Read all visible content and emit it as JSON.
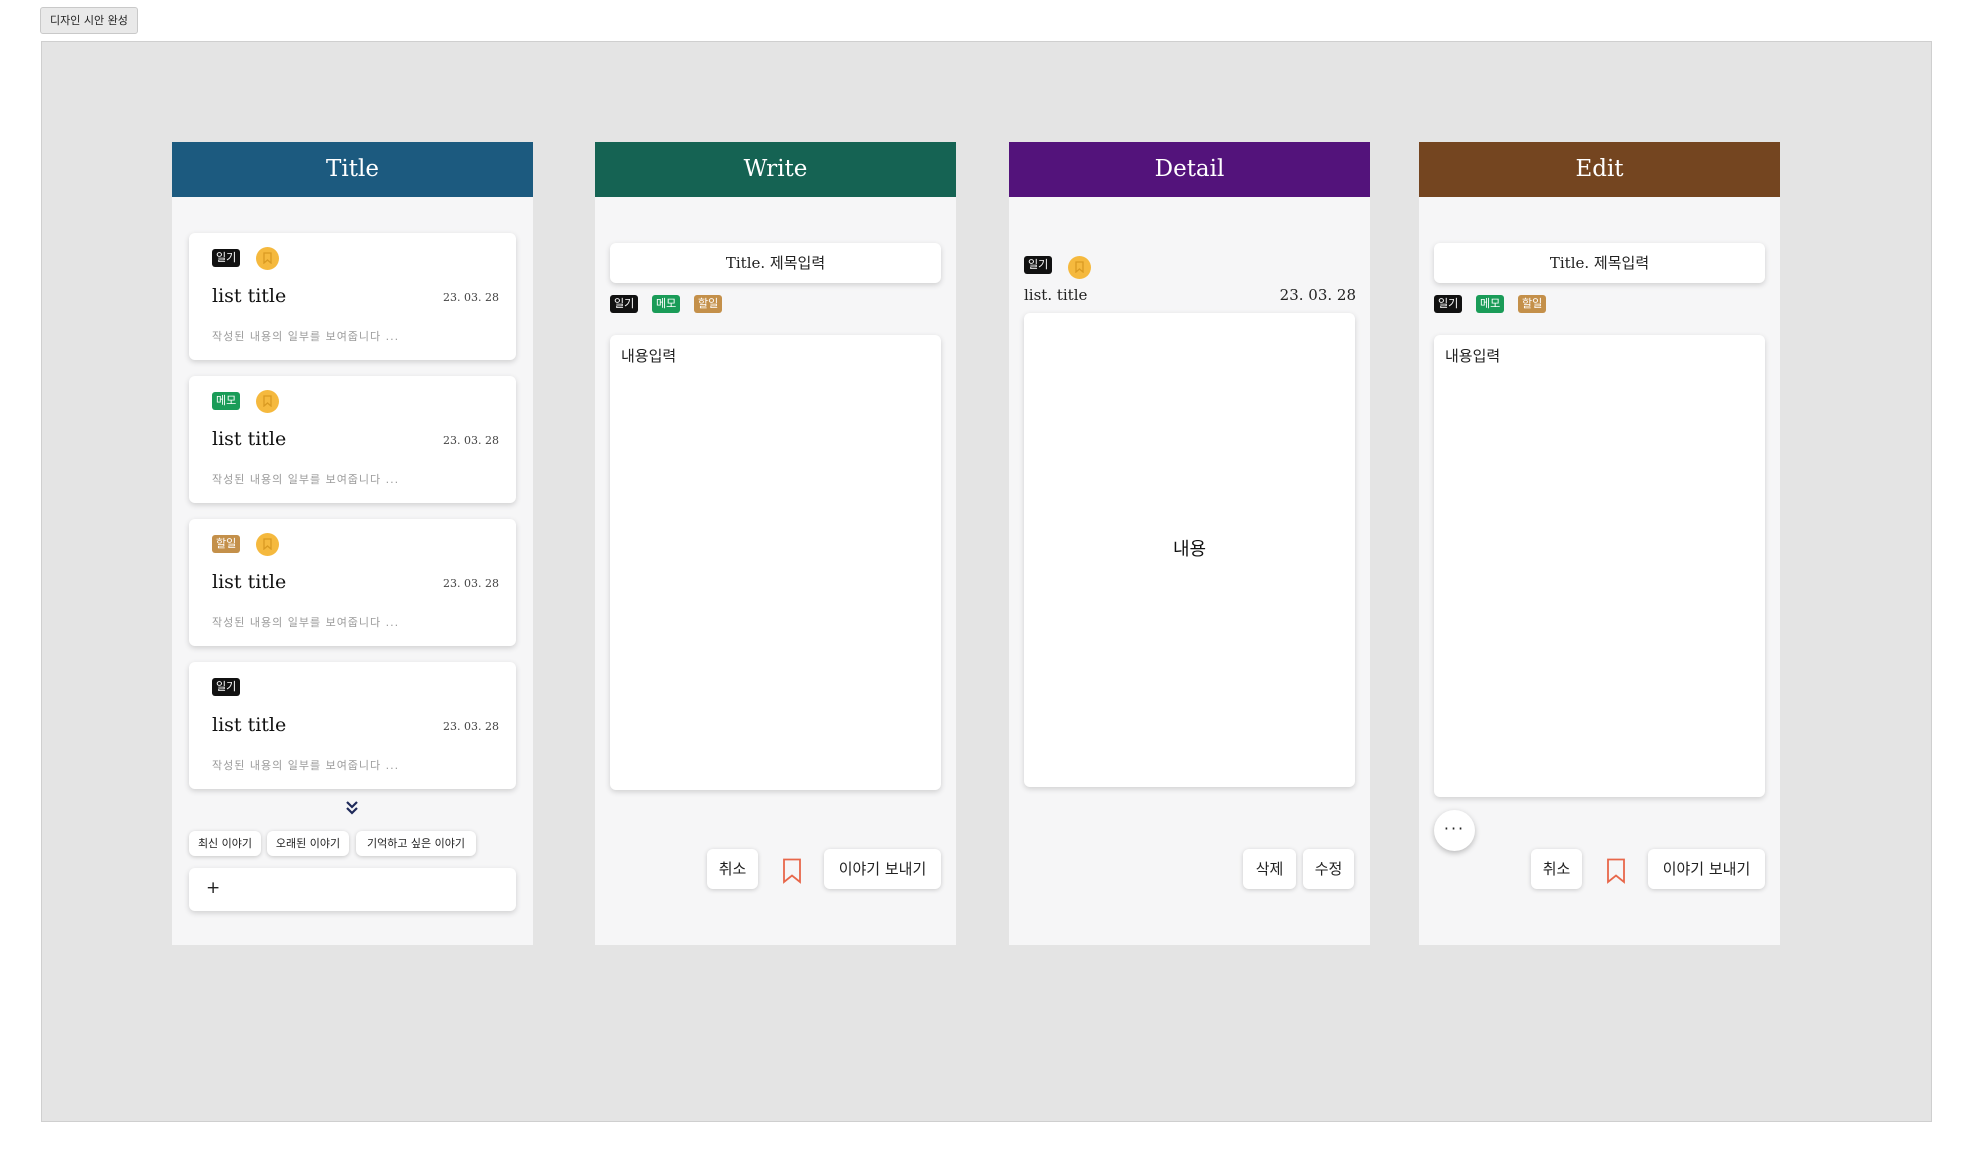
{
  "frame_label": "디자인 시안 완성",
  "colors": {
    "list_header": "#1c5a7f",
    "write_header": "#156353",
    "detail_header": "#53137b",
    "edit_header": "#744520",
    "tag_diary": "#111111",
    "tag_memo": "#1a9c58",
    "tag_todo": "#c4904a",
    "bookmark": "#f5b93e",
    "bookmark_outline": "#e8674a"
  },
  "list_screen": {
    "title": "Title",
    "cards": [
      {
        "tag": "일기",
        "title": "list title",
        "date": "23. 03. 28",
        "preview": "작성된 내용의 일부를 보여줍니다 ...",
        "bookmarked": true
      },
      {
        "tag": "메모",
        "title": "list title",
        "date": "23. 03. 28",
        "preview": "작성된 내용의 일부를 보여줍니다 ...",
        "bookmarked": true
      },
      {
        "tag": "할일",
        "title": "list title",
        "date": "23. 03. 28",
        "preview": "작성된 내용의 일부를 보여줍니다 ...",
        "bookmarked": true
      },
      {
        "tag": "일기",
        "title": "list title",
        "date": "23. 03. 28",
        "preview": "작성된 내용의 일부를 보여줍니다 ...",
        "bookmarked": false
      }
    ],
    "more_icon": "double-chevron-down-icon",
    "sort_buttons": [
      "최신 이야기",
      "오래된 이야기",
      "기억하고 싶은 이야기"
    ],
    "add_button": "+"
  },
  "write_screen": {
    "title": "Write",
    "title_placeholder": "Title. 제목입력",
    "tags": [
      "일기",
      "메모",
      "할일"
    ],
    "content_placeholder": "내용입력",
    "cancel": "취소",
    "send": "이야기 보내기"
  },
  "detail_screen": {
    "title": "Detail",
    "tag": "일기",
    "item_title": "list. title",
    "date": "23. 03. 28",
    "content": "내용",
    "delete": "삭제",
    "edit": "수정"
  },
  "edit_screen": {
    "title": "Edit",
    "title_placeholder": "Title. 제목입력",
    "tags": [
      "일기",
      "메모",
      "할일"
    ],
    "content_placeholder": "내용입력",
    "more": "···",
    "cancel": "취소",
    "send": "이야기 보내기"
  }
}
